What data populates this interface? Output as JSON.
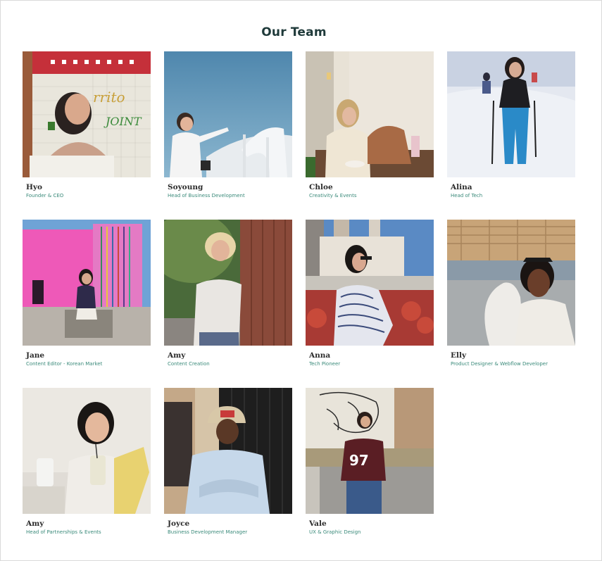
{
  "page": {
    "title": "Our Team"
  },
  "members": [
    {
      "name": "Hyo",
      "role": "Founder & CEO",
      "photo": "member-photo-hyo"
    },
    {
      "name": "Soyoung",
      "role": "Head of Business Development",
      "photo": "member-photo-soyoung"
    },
    {
      "name": "Chloe",
      "role": "Creativity & Events",
      "photo": "member-photo-chloe"
    },
    {
      "name": "Alina",
      "role": "Head of Tech",
      "photo": "member-photo-alina"
    },
    {
      "name": "Jane",
      "role": "Content Editor - Korean Market",
      "photo": "member-photo-jane"
    },
    {
      "name": "Amy",
      "role": "Content Creation",
      "photo": "member-photo-amy"
    },
    {
      "name": "Anna",
      "role": "Tech Pioneer",
      "photo": "member-photo-anna"
    },
    {
      "name": "Elly",
      "role": "Product Designer & Webflow Developer",
      "photo": "member-photo-elly"
    },
    {
      "name": "Amy",
      "role": "Head of Partnerships & Events",
      "photo": "member-photo-amy-2"
    },
    {
      "name": "Joyce",
      "role": "Business Development Manager",
      "photo": "member-photo-joyce"
    },
    {
      "name": "Vale",
      "role": "UX & Graphic Design",
      "photo": "member-photo-vale"
    }
  ]
}
